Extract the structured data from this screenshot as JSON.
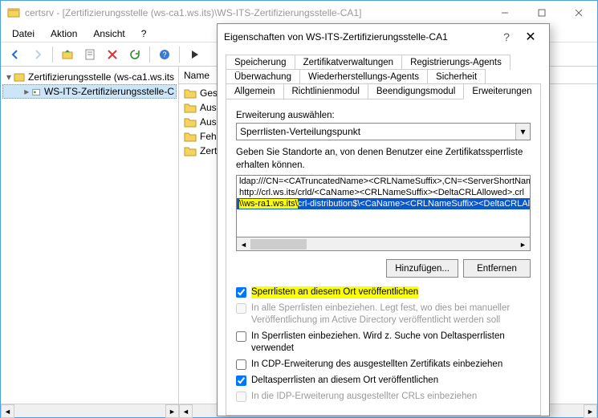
{
  "window": {
    "title": "certsrv - [Zertifizierungsstelle (ws-ca1.ws.its)\\WS-ITS-Zertifizierungsstelle-CA1]",
    "menus": [
      "Datei",
      "Aktion",
      "Ansicht",
      "?"
    ]
  },
  "tree": {
    "root": "Zertifizierungsstelle (ws-ca1.ws.its",
    "child": "WS-ITS-Zertifizierungsstelle-C"
  },
  "list": {
    "header": "Name",
    "items": [
      "Gespe",
      "Ausge",
      "Ausste",
      "Fehlge",
      "Zertifi"
    ]
  },
  "dialog": {
    "title": "Eigenschaften von WS-ITS-Zertifizierungsstelle-CA1",
    "tabs_row1": [
      "Speicherung",
      "Zertifikatverwaltungen",
      "Registrierungs-Agents"
    ],
    "tabs_row2": [
      "Überwachung",
      "Wiederherstellungs-Agents",
      "Sicherheit"
    ],
    "tabs_row3": [
      "Allgemein",
      "Richtlinienmodul",
      "Beendigungsmodul",
      "Erweiterungen"
    ],
    "active_tab": "Erweiterungen",
    "ext_select_label": "Erweiterung auswählen:",
    "ext_select_value": "Sperrlisten-Verteilungspunkt",
    "desc": "Geben Sie Standorte an, von denen Benutzer eine Zertifikatssperrliste erhalten können.",
    "listbox": [
      {
        "segments": [
          {
            "text": "ldap:///CN=<CATruncatedName><CRLNameSuffix>,CN=<ServerShortNam"
          }
        ]
      },
      {
        "segments": [
          {
            "text": "http://crl.ws.its/crld/<CaName><CRLNameSuffix><DeltaCRLAllowed>.crl"
          }
        ]
      },
      {
        "selected": true,
        "segments": [
          {
            "text": "\\\\ws-ra1.ws.its\\",
            "highlight": true
          },
          {
            "text": "crl-distribution$\\<CaName><CRLNameSuffix><DeltaCRLAl"
          }
        ]
      }
    ],
    "buttons": {
      "add": "Hinzufügen...",
      "remove": "Entfernen"
    },
    "checkboxes": [
      {
        "checked": true,
        "disabled": false,
        "highlight": true,
        "label": "Sperrlisten an diesem Ort veröffentlichen"
      },
      {
        "checked": false,
        "disabled": true,
        "highlight": false,
        "label": "In alle Sperrlisten einbeziehen. Legt fest, wo dies bei manueller Veröffentlichung im Active Directory veröffentlicht werden soll"
      },
      {
        "checked": false,
        "disabled": false,
        "highlight": false,
        "label": "In Sperrlisten einbeziehen. Wird z. Suche von Deltasperrlisten verwendet"
      },
      {
        "checked": false,
        "disabled": false,
        "highlight": false,
        "label": "In CDP-Erweiterung des ausgestellten Zertifikats einbeziehen"
      },
      {
        "checked": true,
        "disabled": false,
        "highlight": false,
        "label": "Deltasperrlisten an diesem Ort veröffentlichen"
      },
      {
        "checked": false,
        "disabled": true,
        "highlight": false,
        "label": "In die IDP-Erweiterung ausgestellter CRLs einbeziehen"
      }
    ]
  }
}
